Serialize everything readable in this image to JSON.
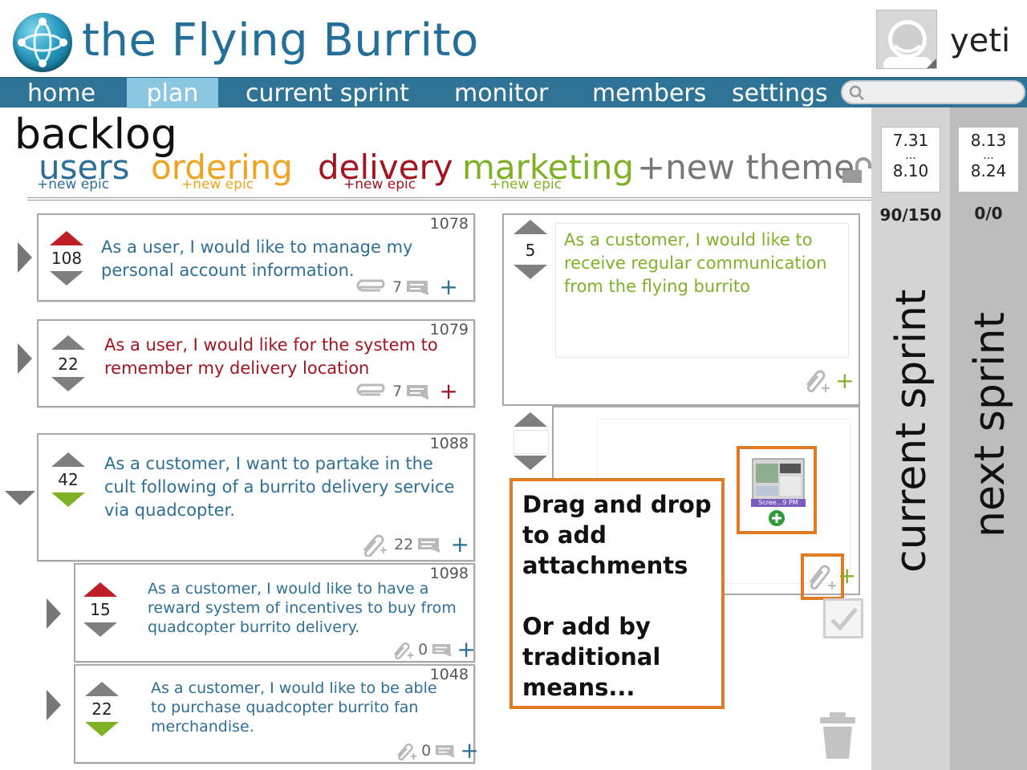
{
  "app": {
    "title": "the Flying Burrito"
  },
  "user": {
    "name": "yeti"
  },
  "nav": {
    "items": [
      {
        "label": "home",
        "active": false
      },
      {
        "label": "plan",
        "active": true
      },
      {
        "label": "current sprint",
        "active": false
      },
      {
        "label": "monitor",
        "active": false
      },
      {
        "label": "members",
        "active": false
      },
      {
        "label": "settings",
        "active": false
      }
    ]
  },
  "backlog": {
    "title": "backlog",
    "themes": [
      {
        "label": "users",
        "epic_label": "+new epic",
        "color": "#2d6f96"
      },
      {
        "label": "ordering",
        "epic_label": "+new epic",
        "color": "#f0a31f"
      },
      {
        "label": "delivery",
        "epic_label": "+new epic",
        "color": "#a31420"
      },
      {
        "label": "marketing",
        "epic_label": "+new epic",
        "color": "#7eb126"
      }
    ],
    "new_theme_label": "+new theme"
  },
  "stories": [
    {
      "id": "1078",
      "votes": "108",
      "text": "As a user, I would like to manage my personal account information.",
      "comments": "7",
      "color": "#2d6f96",
      "vote_state": "up"
    },
    {
      "id": "1079",
      "votes": "22",
      "text": "As a user, I would like for the system to remember my delivery location",
      "comments": "7",
      "color": "#a31420",
      "vote_state": "none"
    },
    {
      "id": "1088",
      "votes": "42",
      "text": "As a customer, I want to partake in the cult following of  a burrito delivery service via quadcopter.",
      "comments": "22",
      "color": "#2d6f96",
      "vote_state": "down"
    },
    {
      "id": "1098",
      "votes": "15",
      "text": "As a customer, I would like to have a reward system of  incentives to buy from quadcopter burrito delivery.",
      "comments": "0",
      "color": "#2d6f96",
      "vote_state": "up"
    },
    {
      "id": "1048",
      "votes": "22",
      "text": "As a customer, I would like to be able to purchase quadcopter burrito fan merchandise.",
      "comments": "0",
      "color": "#2d6f96",
      "vote_state": "down"
    }
  ],
  "detail_card": {
    "votes": "5",
    "text": "As a customer, I would like to receive regular communication from the flying burrito",
    "color": "#7eb126"
  },
  "attachment": {
    "thumb_label": "Scree...9 PM"
  },
  "callout": {
    "line1": "Drag and drop",
    "line2": "to add",
    "line3": "attachments",
    "line4": "Or add by",
    "line5": "traditional",
    "line6": "means..."
  },
  "sprints": [
    {
      "name": "current sprint",
      "start": "7.31",
      "sep": "...",
      "end": "8.10",
      "points": "90/150"
    },
    {
      "name": "next sprint",
      "start": "8.13",
      "sep": "...",
      "end": "8.24",
      "points": "0/0"
    }
  ],
  "colors": {
    "nav": "#2f7497",
    "nav_active": "#8cc7e2",
    "accent_orange": "#e07b24",
    "vote_up": "#c01e27",
    "vote_down": "#7eb126"
  }
}
